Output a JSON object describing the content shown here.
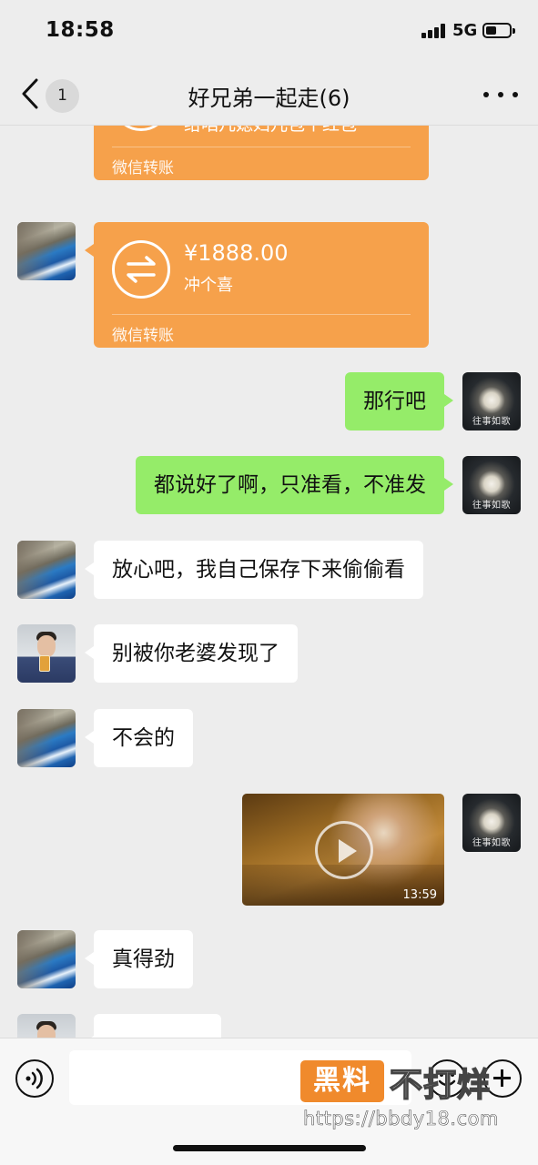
{
  "status_bar": {
    "time": "18:58",
    "network": "5G",
    "battery_level": 0.45
  },
  "nav": {
    "unread_count": "1",
    "title": "好兄弟一起走(6)"
  },
  "messages": [
    {
      "side": "left",
      "type": "transfer",
      "avatar": "sea-cliff-avatar",
      "amount": "",
      "note": "给咱几媳妇儿包个红包",
      "label": "微信转账"
    },
    {
      "side": "left",
      "type": "transfer",
      "avatar": "sea-cliff-avatar",
      "amount": "¥1888.00",
      "note": "冲个喜",
      "label": "微信转账"
    },
    {
      "side": "right",
      "type": "text",
      "avatar": "flower-avatar",
      "avatar_caption": "往事如歌",
      "text": "那行吧"
    },
    {
      "side": "right",
      "type": "text",
      "avatar": "flower-avatar",
      "avatar_caption": "往事如歌",
      "text": "都说好了啊，只准看，不准发"
    },
    {
      "side": "left",
      "type": "text",
      "avatar": "sea-cliff-avatar",
      "text": "放心吧，我自己保存下来偷偷看"
    },
    {
      "side": "left",
      "type": "text",
      "avatar": "man-with-beer-avatar",
      "text": "别被你老婆发现了"
    },
    {
      "side": "left",
      "type": "text",
      "avatar": "sea-cliff-avatar",
      "text": "不会的"
    },
    {
      "side": "right",
      "type": "video",
      "avatar": "flower-avatar",
      "avatar_caption": "往事如歌",
      "duration": "13:59"
    },
    {
      "side": "left",
      "type": "text",
      "avatar": "sea-cliff-avatar",
      "text": "真得劲"
    },
    {
      "side": "left",
      "type": "text",
      "avatar": "man-with-beer-avatar",
      "text": ""
    }
  ],
  "input": {
    "placeholder": ""
  },
  "watermark": {
    "badge": "黑料",
    "text": "不打烊",
    "url": "https://bbdy18.com"
  },
  "colors": {
    "background": "#ededed",
    "transfer": "#f6a14b",
    "outgoing_bubble": "#95ec69",
    "incoming_bubble": "#ffffff"
  }
}
